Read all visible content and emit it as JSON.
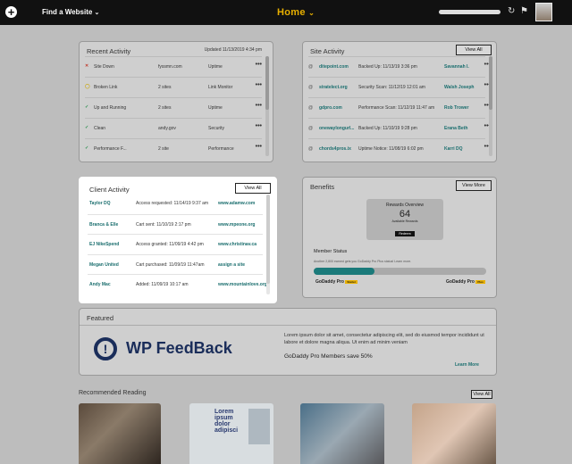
{
  "topbar": {
    "find_label": "Find a Website",
    "home_label": "Home"
  },
  "recent_activity": {
    "title": "Recent Activity",
    "updated": "Updated 11/13/2019 4:34 pm",
    "rows": [
      {
        "status": "Site Down",
        "site": "fyssmn.com",
        "type": "Uptime",
        "icon": "x-icon",
        "color": "#c0392b"
      },
      {
        "status": "Broken Link",
        "site": "2 sites",
        "type": "Link Monitor",
        "icon": "warning-icon",
        "color": "#c9a400"
      },
      {
        "status": "Up and Running",
        "site": "2 sites",
        "type": "Uptime",
        "icon": "check-icon",
        "color": "#2a8f4d"
      },
      {
        "status": "Clean",
        "site": "andy.gov",
        "type": "Security",
        "icon": "check-icon",
        "color": "#2a8f4d"
      },
      {
        "status": "Performance F...",
        "site": "2 site",
        "type": "Performance",
        "icon": "check-icon",
        "color": "#2a8f4d"
      }
    ]
  },
  "site_activity": {
    "title": "Site Activity",
    "view_all": "View All",
    "rows": [
      {
        "site": "ditepoint.com",
        "action": "Backed Up: 11/13/19 3:36 pm",
        "user": "Savannah I."
      },
      {
        "site": "stratelect.org",
        "action": "Security Scan: 11/12/19 12:01 am",
        "user": "Walsh Joseph"
      },
      {
        "site": "gdpro.com",
        "action": "Performance Scan: 11/12/19 11:47 am",
        "user": "Rob Trower"
      },
      {
        "site": "onewaylongurl...",
        "action": "Backed Up: 11/10/19 9:28 pm",
        "user": "Erana Beth"
      },
      {
        "site": "chords4pros.ix",
        "action": "Uptime Notice: 11/08/19 6:02 pm",
        "user": "Karri DQ"
      }
    ]
  },
  "client_activity": {
    "title": "Client Activity",
    "view_all": "View All",
    "rows": [
      {
        "name": "Taylor DQ",
        "action": "Access requested: 11/14/19 9:37 am",
        "site": "www.adamw.com"
      },
      {
        "name": "Branca & Elle",
        "action": "Cart sent: 11/10/19 2:17 pm",
        "site": "www.mpeone.org"
      },
      {
        "name": "EJ NikeSpend",
        "action": "Access granted: 11/09/19 4:42 pm",
        "site": "www.christinav.ca"
      },
      {
        "name": "Megan United",
        "action": "Cart purchased: 11/09/19 11:47am",
        "site": "assign a site"
      },
      {
        "name": "Andy Mac",
        "action": "Added: 11/09/19 10:17 am",
        "site": "www.mountainlove.org"
      }
    ]
  },
  "benefits": {
    "title": "Benefits",
    "view_more": "View More",
    "rewards_title": "Rewards Overview",
    "rewards_value": "64",
    "rewards_sub": "Available Rewards",
    "rewards_btn": "Redeem",
    "member_status": "Member Status",
    "member_note": "Another 2,800 earned gets you GoDaddy Pro Plus status! Learn more.",
    "progress": 0.35,
    "tier_left": "GoDaddy Pro",
    "tier_left_badge": "Starter",
    "tier_right": "GoDaddy Pro",
    "tier_right_badge": "Plus"
  },
  "featured": {
    "title": "Featured",
    "brand": "WP FeedBack",
    "desc": "Lorem ipsum dolor sit amet, consectetur adipiscing elit, sed do eiusmod tempor incididunt ut labore et dolore magna aliqua. Ut enim ad minim veniam",
    "offer": "GoDaddy Pro Members save 50%",
    "learn_more": "Learn More"
  },
  "recommended": {
    "title": "Recommended Reading",
    "view_all": "View All",
    "thumb2_text": "Lorem ipsum dolor adipisci"
  }
}
